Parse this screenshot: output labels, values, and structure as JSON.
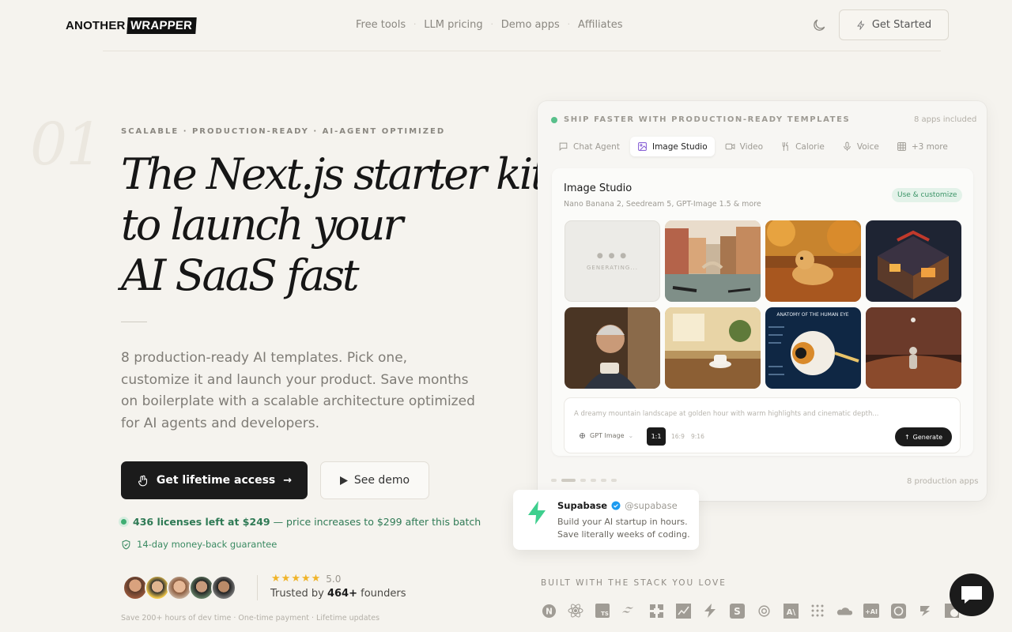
{
  "header": {
    "logo_part1": "ANOTHER",
    "logo_part2": "WRAPPER",
    "nav": [
      "Free tools",
      "LLM pricing",
      "Demo apps",
      "Affiliates"
    ],
    "cta": "Get Started"
  },
  "hero": {
    "index": "01",
    "eyebrow": "SCALABLE · PRODUCTION-READY · AI-AGENT OPTIMIZED",
    "headline": [
      "The Next.js starter kit",
      "to launch your",
      "AI SaaS fast"
    ],
    "description": "8 production-ready AI templates. Pick one, customize it and launch your product. Save months on boilerplate with a scalable architecture optimized for AI agents and developers.",
    "primary_cta": "Get lifetime access",
    "secondary_cta": "See demo",
    "licenses_bold": "436 licenses left at $249",
    "licenses_rest": "— price increases to $299 after this batch",
    "guarantee": "14-day money-back guarantee",
    "rating": "5.0",
    "trusted_prefix": "Trusted by",
    "trusted_count": "464+",
    "trusted_suffix": "founders",
    "footnote": "Save 200+ hours of dev time · One-time payment · Lifetime updates"
  },
  "showcase": {
    "heading": "SHIP FASTER WITH PRODUCTION-READY TEMPLATES",
    "apps_included": "8 apps included",
    "tabs": [
      "Chat Agent",
      "Image Studio",
      "Video",
      "Calorie",
      "Voice",
      "+3 more"
    ],
    "active_tab": "Image Studio",
    "studio_title": "Image Studio",
    "studio_subtitle": "Nano Banana 2, Seedream 5, GPT-Image 1.5 & more",
    "badge": "Use & customize",
    "generating": "GENERATING...",
    "images": [
      "Venice canal",
      "Golden retriever in autumn leaves",
      "Isometric ramen shop",
      "Elderly woman portrait",
      "Cozy cafe",
      "Anatomy of the human eye",
      "Astronaut on Mars"
    ],
    "eye_caption": "ANATOMY OF THE HUMAN EYE",
    "prompt": "A dreamy mountain landscape at golden hour with warm highlights and cinematic depth...",
    "model": "GPT Image",
    "ratios": [
      "1:1",
      "16:9",
      "9:16"
    ],
    "generate": "Generate",
    "footer": "8 production apps"
  },
  "testimonial": {
    "name": "Supabase",
    "handle": "@supabase",
    "quote_line1": "Build your AI startup in hours.",
    "quote_line2": "Save literally weeks of coding."
  },
  "stack": {
    "title": "BUILT WITH THE STACK YOU LOVE",
    "items": [
      "nextjs-icon",
      "react-icon",
      "typescript-icon",
      "tailwind-icon",
      "shadcn-icon",
      "chart-icon",
      "bolt-icon",
      "stripe-icon",
      "openai-icon",
      "anthropic-icon",
      "replicate-icon",
      "cloudflare-icon",
      "ai-sdk-icon",
      "mistral-icon",
      "deepseek-icon",
      "lemonsqueezy-icon"
    ]
  },
  "colors": {
    "background": "#f5f3ee",
    "accent_green": "#3fae73",
    "dark": "#1b1b1b",
    "star": "#f0b429"
  }
}
